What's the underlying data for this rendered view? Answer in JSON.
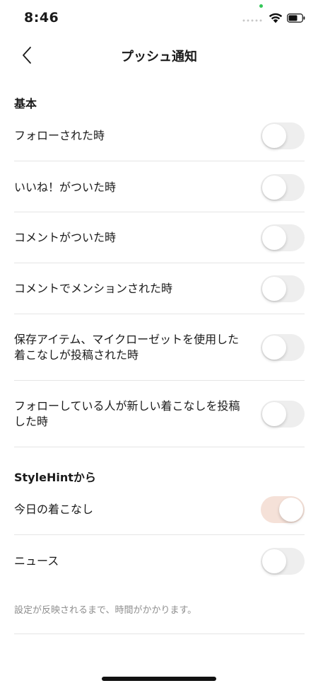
{
  "status_bar": {
    "time": "8:46",
    "indicator_color": "#34c759"
  },
  "nav": {
    "title": "プッシュ通知",
    "back_icon": "chevron-left-icon"
  },
  "sections": [
    {
      "header": "基本",
      "items": [
        {
          "label": "フォローされた時",
          "enabled": false
        },
        {
          "label": "いいね！がついた時",
          "enabled": false
        },
        {
          "label": "コメントがついた時",
          "enabled": false
        },
        {
          "label": "コメントでメンションされた時",
          "enabled": false
        },
        {
          "label": "保存アイテム、マイクローゼットを使用した着こなしが投稿された時",
          "enabled": false
        },
        {
          "label": "フォローしている人が新しい着こなしを投稿した時",
          "enabled": false
        }
      ]
    },
    {
      "header": "StyleHintから",
      "items": [
        {
          "label": "今日の着こなし",
          "enabled": true
        },
        {
          "label": "ニュース",
          "enabled": false
        }
      ]
    }
  ],
  "footnote": "設定が反映されるまで、時間がかかります。",
  "colors": {
    "toggle_on": "#f5e1d8",
    "toggle_off": "#eeeeee"
  }
}
